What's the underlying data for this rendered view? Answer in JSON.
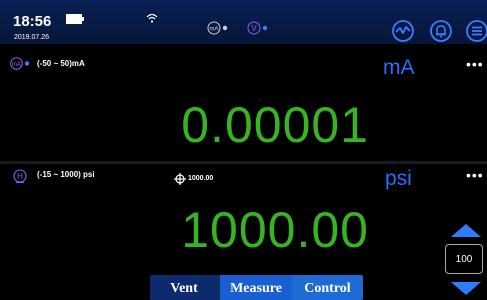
{
  "status_bar": {
    "time": "18:56",
    "date": "2019.07.26",
    "ma_indicator": "mA",
    "v_indicator": "V"
  },
  "channel_1": {
    "range": "(-50 ~ 50)mA",
    "unit": "mA",
    "reading": "0.00001",
    "icon_label": "mA"
  },
  "channel_2": {
    "range": "(-15 ~ 1000) psi",
    "unit": "psi",
    "reading": "1000.00",
    "setpoint": "1000.00",
    "icon_label": "H"
  },
  "mode_buttons": {
    "vent": "Vent",
    "measure": "Measure",
    "control": "Control"
  },
  "step": {
    "value": "100"
  },
  "colors": {
    "reading": "#38b321",
    "unit": "#2c6cff",
    "accent": "#1f6bd6"
  }
}
